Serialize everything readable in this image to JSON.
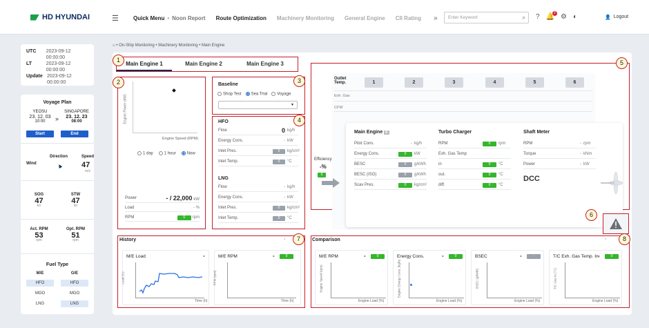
{
  "header": {
    "brand": "HD HYUNDAI",
    "nav": [
      "Quick Menu",
      "Noon Report",
      "Route Optimization",
      "Machinery Monitoring",
      "General Engine",
      "CII Rating"
    ],
    "search_placeholder": "Enter Keyword",
    "notification_count": "2",
    "logout": "Logout"
  },
  "breadcrumb": [
    "On-Ship Monitoring",
    "Machinery Monitoring",
    "Main Engine"
  ],
  "time": {
    "utc_label": "UTC",
    "utc_value": "2023-09-12 00:00:00",
    "lt_label": "LT",
    "lt_value": "2023-09-12 00:00:00",
    "update_label": "Update",
    "update_value": "2023-09-12 00:00:00"
  },
  "voyage": {
    "title": "Voyage Plan",
    "from_port": "YEOSU",
    "from_date": "23. 12. 03",
    "from_time": "10:00",
    "to_port": "SINGAPORE",
    "to_date": "23. 12. 23",
    "to_time": "08:00",
    "start": "Start",
    "end": "End",
    "wind": "Wind",
    "direction": "Direction",
    "speed_label": "Speed",
    "speed_value": "47",
    "speed_unit": "m/s",
    "sog_label": "SOG",
    "sog_value": "47",
    "sog_unit": "kn",
    "stw_label": "STW",
    "stw_value": "47",
    "stw_unit": "kn",
    "act_rpm_label": "Act. RPM",
    "act_rpm_value": "53",
    "act_rpm_unit": "rpm",
    "opt_rpm_label": "Opt. RPM",
    "opt_rpm_value": "51",
    "opt_rpm_unit": "rpm"
  },
  "fuel": {
    "title": "Fuel Type",
    "me": "M/E",
    "ge": "G/E",
    "rows": [
      [
        "HFO",
        "HFO"
      ],
      [
        "MGO",
        "MGO"
      ],
      [
        "LNG",
        "LNG"
      ]
    ]
  },
  "tabs": [
    "Main Engine 1",
    "Main Engine 2",
    "Main Engine 3"
  ],
  "annotations": [
    "1",
    "2",
    "3",
    "4",
    "5",
    "6",
    "7",
    "8"
  ],
  "power_chart": {
    "ylabel": "Engine Power (kW)",
    "xlabel": "Engine Speed (RPM)",
    "ranges": [
      "1 day",
      "1 hour",
      "Now"
    ],
    "power_label": "Power",
    "power_value": "- / 22,000",
    "power_unit": "kW",
    "load_label": "Load",
    "load_value": "-",
    "load_unit": "%",
    "rpm_label": "RPM",
    "rpm_value": "0",
    "rpm_unit": "rpm"
  },
  "baseline": {
    "title": "Baseline",
    "options": [
      "Shop Test",
      "Sea Trial",
      "Voyage"
    ]
  },
  "hfo": {
    "title": "HFO",
    "rows": [
      {
        "label": "Flow",
        "value": "0",
        "unit": "kg/h"
      },
      {
        "label": "Energy Cons.",
        "value": "-",
        "unit": "kW"
      },
      {
        "label": "Inlet Pres.",
        "value": "0",
        "unit": "kg/cm²"
      },
      {
        "label": "Inlet Temp.",
        "value": "0",
        "unit": "°C"
      }
    ]
  },
  "lng": {
    "title": "LNG",
    "rows": [
      {
        "label": "Flow",
        "value": "-",
        "unit": "kg/h"
      },
      {
        "label": "Energy Cons.",
        "value": "-",
        "unit": "kW"
      },
      {
        "label": "Inlet Pres.",
        "value": "0",
        "unit": "kg/cm²"
      },
      {
        "label": "Inlet Temp.",
        "value": "0",
        "unit": "°C"
      }
    ]
  },
  "engine": {
    "outlet_temp": "Outlet Temp.",
    "exh_gas": "Exh. Gas",
    "cfw": "CFW",
    "cylinders": [
      "1",
      "2",
      "3",
      "4",
      "5",
      "6"
    ],
    "efficiency_label": "Efficiency",
    "efficiency_value": "-%",
    "efficiency_box": "0",
    "main_engine": {
      "title": "Main Engine",
      "rows": [
        {
          "label": "Pilot Cons.",
          "value": "-",
          "unit": "kg/h"
        },
        {
          "label": "Energy Cons.",
          "value": "0",
          "unit": "kW"
        },
        {
          "label": "BESC",
          "value": "0",
          "unit": "g/kWh"
        },
        {
          "label": "BESC (ISO)",
          "value": "0",
          "unit": "g/kWh"
        },
        {
          "label": "Scav Pres.",
          "value": "0",
          "unit": "kg/cm²"
        }
      ]
    },
    "turbo": {
      "title": "Turbo Charger",
      "rows": [
        {
          "label": "RPM",
          "value": "0",
          "unit": "rpm"
        },
        {
          "label": "Exh. Gas Temp",
          "value": "",
          "unit": ""
        },
        {
          "label": "in",
          "value": "0",
          "unit": "°C"
        },
        {
          "label": "out.",
          "value": "0",
          "unit": "°C"
        },
        {
          "label": "diff.",
          "value": "0",
          "unit": "°C"
        }
      ]
    },
    "shaft": {
      "title": "Shaft Meter",
      "rows": [
        {
          "label": "RPM",
          "value": "-",
          "unit": "rpm"
        },
        {
          "label": "Torque",
          "value": "-",
          "unit": "kNm"
        },
        {
          "label": "Power",
          "value": "-",
          "unit": "kW"
        }
      ],
      "dcc": "DCC"
    }
  },
  "history": {
    "title": "History",
    "cards": [
      {
        "title": "M/E Load",
        "value": "-",
        "ylabel": "Load (%)",
        "xlabel": "Time (h)"
      },
      {
        "title": "M/E RPM",
        "value": "-",
        "box": "0",
        "ylabel": "RPM (rpm)",
        "xlabel": "Time (h)"
      }
    ]
  },
  "comparison": {
    "title": "Comparison",
    "cards": [
      {
        "title": "M/E RPM",
        "value": "-",
        "box": "0",
        "ylabel": "Engine Speed (rpm)",
        "xlabel": "Engine Load (%)"
      },
      {
        "title": "Energy Cons.",
        "value": "-",
        "box": "0",
        "ylabel": "Engine Energy Cons. (kg/h)",
        "xlabel": "Engine Load (%)"
      },
      {
        "title": "BSEC",
        "value": "-",
        "box": "-",
        "ylabel": "BSEC (g/kWh)",
        "xlabel": "Engine Load (%)"
      },
      {
        "title": "T/C Exh. Gas Temp. In.",
        "value": "-",
        "box": "0",
        "ylabel": "T/C Gas In (°C)",
        "xlabel": "Engine Load (%)"
      }
    ]
  },
  "colors": {
    "accent": "#1f5fc9",
    "ok": "#35b62c",
    "annotation": "#c31e2a",
    "brand": "#1aa04a"
  }
}
